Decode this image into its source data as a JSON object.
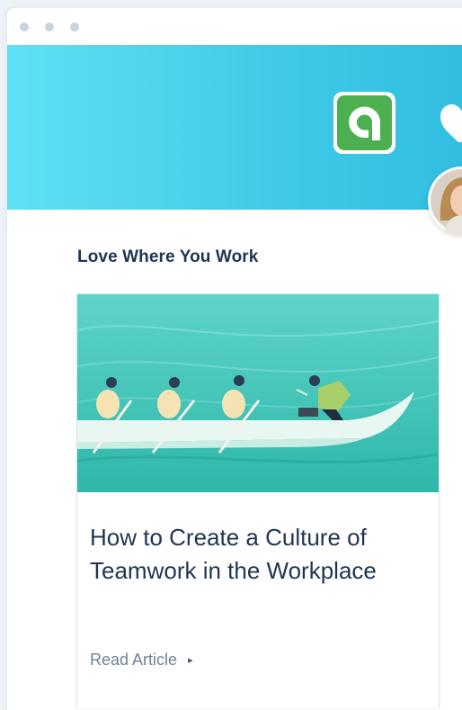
{
  "section": {
    "title": "Love Where You Work"
  },
  "article": {
    "title": "How to Create a Culture of Teamwork in the Workplace",
    "link_label": "Read Article",
    "link_arrow": "▸",
    "image_icon": "rowing-team-illustration"
  },
  "header": {
    "logo_icon": "app-logo-icon",
    "heart_icon": "heart-icon",
    "avatar_icon": "user-avatar"
  },
  "colors": {
    "hero_start": "#5fe0f3",
    "hero_end": "#2fbde0",
    "logo_green": "#4caf50",
    "title_text": "#1f3552",
    "link_text": "#6f8296"
  }
}
